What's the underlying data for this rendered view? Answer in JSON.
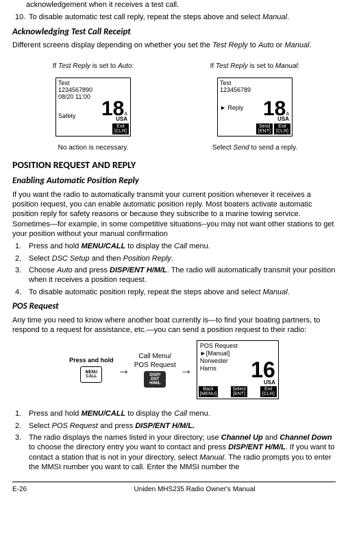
{
  "intro": {
    "ack_line": "acknowledgement when it receives a test call.",
    "step10_num": "10.",
    "step10": "To disable automatic test call reply, repeat the steps above and select ",
    "step10_em": "Manual",
    "step10_end": "."
  },
  "ack_section": {
    "heading": "Acknowledging Test Call Receipt",
    "body_pre": "Different screens display depending on whether you set the ",
    "body_em1": "Test Reply",
    "body_mid": " to ",
    "body_em2": "Auto",
    "body_or": " or ",
    "body_em3": "Manual",
    "body_end": "."
  },
  "screens": {
    "left": {
      "cap_pre": "If ",
      "cap_em": "Test Reply",
      "cap_mid": " is set to ",
      "cap_mode": "Auto",
      "cap_end": ":",
      "l1": "Test",
      "l2": "1234567890",
      "l3": "08/20  11:00",
      "safety": "Safety",
      "ch": "18",
      "chA": "A",
      "usa": "USA",
      "btn_exit1": "Exit",
      "btn_exit2": "[CLR]",
      "bottom": "No action is necessary."
    },
    "right": {
      "cap_pre": "If ",
      "cap_em": "Test Reply",
      "cap_mid": " is set to ",
      "cap_mode": "Manual",
      "cap_end": ":",
      "l1": "Test",
      "l2": "123456789",
      "reply": "► Reply",
      "ch": "18",
      "chA": "A",
      "usa": "USA",
      "btn_send1": "Send",
      "btn_send2": "[ENT]",
      "btn_exit1": "Exit",
      "btn_exit2": "[CLR]",
      "bottom_pre": "Select ",
      "bottom_em": "Send",
      "bottom_end": " to send a reply."
    }
  },
  "pos_section": {
    "heading": "POSITION REQUEST AND REPLY",
    "sub1": "Enabling Automatic Position Reply",
    "para": "If you want the radio to automatically transmit your current position whenever it receives a position request, you can enable automatic position reply. Most boaters activate automatic position reply for safety reasons or because they subscribe to a marine towing service. Sometimes—for example, in some competitive situations--you may not want other stations to get your position without your manual confirmation",
    "steps": [
      {
        "num": "1.",
        "pre": "Press and hold ",
        "b": "MENU/CALL",
        "mid": " to display the ",
        "em": "Call",
        "end": " menu."
      },
      {
        "num": "2.",
        "pre": "Select ",
        "em1": "DSC Setup",
        "mid": " and then ",
        "em2": "Position Reply",
        "end": "."
      },
      {
        "num": "3.",
        "pre": "Choose ",
        "em1": "Auto",
        "mid1": " and press ",
        "b": "DISP/ENT H/M/L",
        "mid2": ". The radio will automatically transmit your position when it receives a position request."
      },
      {
        "num": "4.",
        "pre": "To disable automatic position reply, repeat the steps above and select ",
        "em": "Manual",
        "end": "."
      }
    ],
    "sub2": "POS Request",
    "para2": "Any time you need to know where another boat currently is—to find your boating partners, to respond to a request for assistance, etc.—you can send a position request to their radio:"
  },
  "flow": {
    "hold_label": "Press and hold",
    "key1": "MENU\nCALL",
    "mid_label": "Call Menu/\nPOS Request",
    "key2": "DISP/\nENT\nH/M/L",
    "lcd": {
      "title": "POS Request",
      "row1": "►[Manual]",
      "row2": "  Norwester",
      "row3": "  Harris",
      "ch": "16",
      "usa": "USA",
      "back1": "Back",
      "back2": "[MENU]",
      "sel1": "Select",
      "sel2": "[ENT]",
      "exit1": "Exit",
      "exit2": "[CLR]"
    }
  },
  "pos_steps2": [
    {
      "num": "1.",
      "pre": "Press and hold ",
      "b": "MENU/CALL",
      "mid": " to display the ",
      "em": "Call",
      "end": " menu."
    },
    {
      "num": "2.",
      "pre": "Select ",
      "em": "POS Request",
      "mid": " and press ",
      "b": "DISP/ENT H/M/L.",
      "end": ""
    },
    {
      "num": "3.",
      "pre": "The radio displays the names listed in your directory; use ",
      "b1": "Channel Up",
      "mid1": " and ",
      "b2": "Channel Down",
      "mid2": "  to choose the directory entry you want to contact and press ",
      "b3": "DISP/ENT H/M/L",
      "mid3": ". If you want to contact a station that is not in your directory, select ",
      "em": "Manual",
      "end": ". The radio prompts you to enter the MMSI number you want to call. Enter the MMSI number the"
    }
  ],
  "footer": {
    "page": "E-26",
    "title": "Uniden MHS235 Radio Owner's Manual"
  }
}
